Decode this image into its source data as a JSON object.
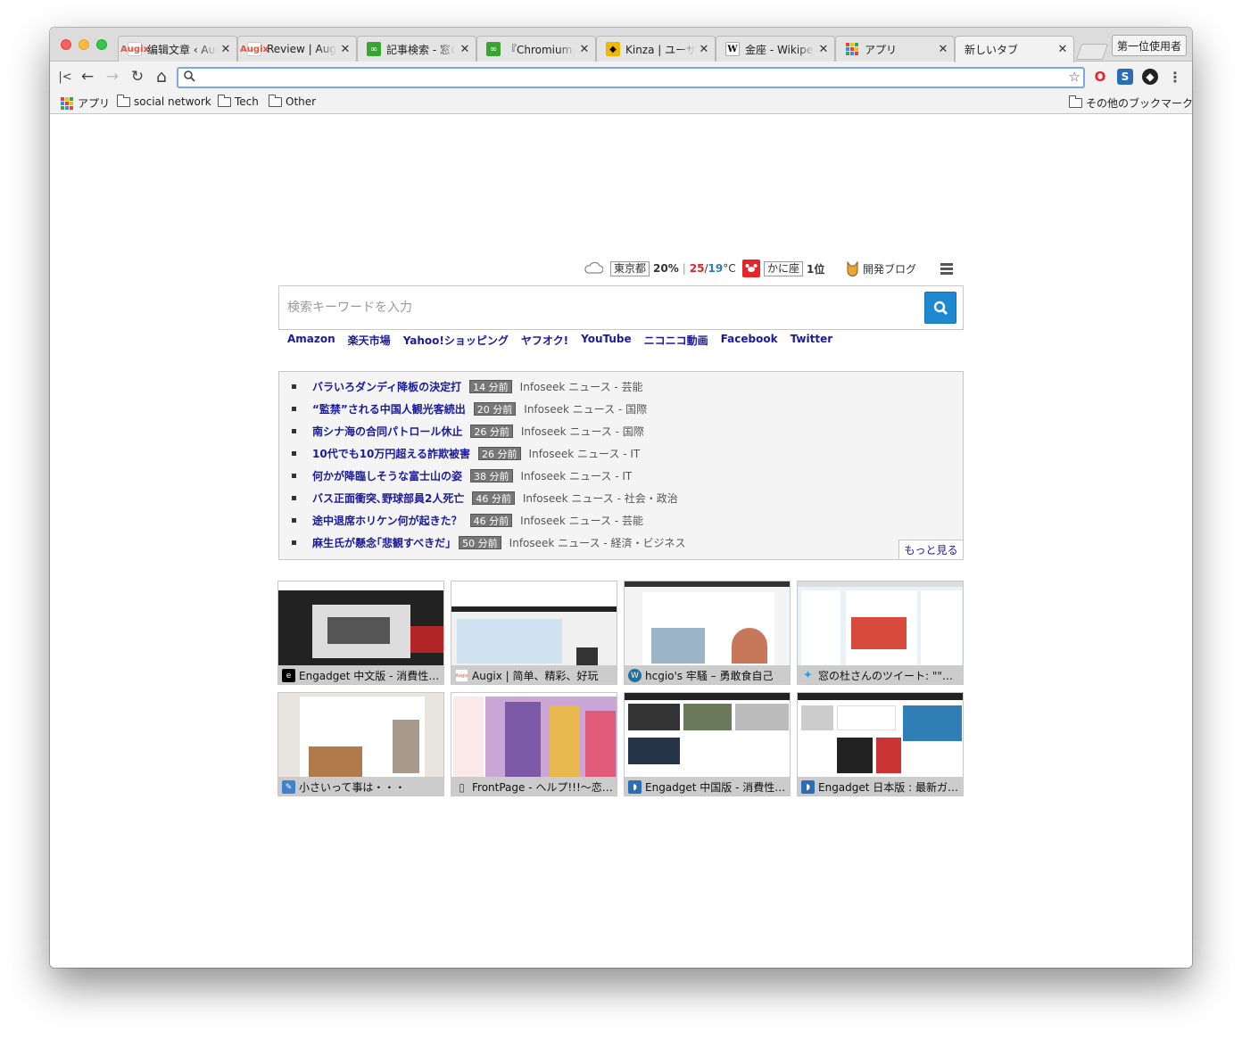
{
  "window": {
    "tabs": [
      {
        "title": "编辑文章 ‹ Aug",
        "favicon": "augix-icon"
      },
      {
        "title": "Review | Augix",
        "favicon": "augix-icon"
      },
      {
        "title": "記事検索 - 窓の",
        "favicon": "madonomori-icon"
      },
      {
        "title": "『Chromium』",
        "favicon": "madonomori-icon"
      },
      {
        "title": "Kinza | ユーザー",
        "favicon": "kinza-icon"
      },
      {
        "title": "金座 - Wikiped",
        "favicon": "wikipedia-icon"
      },
      {
        "title": "アプリ",
        "favicon": "apps-icon"
      },
      {
        "title": "新しいタブ",
        "favicon": "none"
      }
    ],
    "profile_label": "第一位使用者"
  },
  "toolbar": {
    "omnibox_value": "",
    "buttons": [
      "first-page-icon",
      "back-icon",
      "forward-icon",
      "reload-icon",
      "home-icon"
    ],
    "extensions": [
      "opera-icon",
      "s-extension-icon",
      "kinza-icon",
      "menu-dots-icon"
    ]
  },
  "bookmarks": {
    "items": [
      {
        "label": "アプリ",
        "icon": "apps-icon"
      },
      {
        "label": "social network",
        "icon": "folder-icon"
      },
      {
        "label": "Tech",
        "icon": "folder-icon"
      },
      {
        "label": "Other",
        "icon": "folder-icon"
      }
    ],
    "other_label": "その他のブックマーク"
  },
  "infobar": {
    "weather_icon": "cloud-icon",
    "location": "東京都",
    "precip": "20%",
    "temp_high": "25",
    "temp_sep": "/",
    "temp_low": "19",
    "temp_unit": "°C",
    "horoscope_sign": "かに座",
    "horoscope_rank": "1位",
    "dev_blog": "開発ブログ"
  },
  "search": {
    "placeholder": "検索キーワードを入力",
    "quicklinks": [
      "Amazon",
      "楽天市場",
      "Yahoo!ショッピング",
      "ヤフオク!",
      "YouTube",
      "ニコニコ動画",
      "Facebook",
      "Twitter"
    ]
  },
  "news": {
    "items": [
      {
        "title": "バラいろダンディ降板の決定打",
        "age": "14 分前",
        "source": "Infoseek ニュース - 芸能"
      },
      {
        "title": "“監禁”される中国人観光客続出",
        "age": "20 分前",
        "source": "Infoseek ニュース - 国際"
      },
      {
        "title": "南シナ海の合同パトロール休止",
        "age": "26 分前",
        "source": "Infoseek ニュース - 国際"
      },
      {
        "title": "10代でも10万円超える詐欺被害",
        "age": "26 分前",
        "source": "Infoseek ニュース - IT"
      },
      {
        "title": "何かが降臨しそうな富士山の姿",
        "age": "38 分前",
        "source": "Infoseek ニュース - IT"
      },
      {
        "title": "バス正面衝突､野球部員2人死亡",
        "age": "46 分前",
        "source": "Infoseek ニュース - 社会・政治"
      },
      {
        "title": "途中退席ホリケン何が起きた？",
        "age": "46 分前",
        "source": "Infoseek ニュース - 芸能"
      },
      {
        "title": "麻生氏が懸念｢悲観すべきだ｣",
        "age": "50 分前",
        "source": "Infoseek ニュース - 経済・ビジネス"
      }
    ],
    "more_label": "もっと見る"
  },
  "tiles": [
    {
      "caption": "Engadget 中文版 - 消費性電…",
      "icon": "engadget-icon"
    },
    {
      "caption": "Augix | 简单、精彩、好玩",
      "icon": "augix-icon"
    },
    {
      "caption": "hcgio's 牢騷 – 勇敢食自己",
      "icon": "wordpress-icon"
    },
    {
      "caption": "窓の杜さんのツイート: \"\"艦…",
      "icon": "twitter-icon"
    },
    {
      "caption": "小さいって事は・・・",
      "icon": "feather-icon"
    },
    {
      "caption": "FrontPage - ヘルプ!!!〜恋が…",
      "icon": "document-icon"
    },
    {
      "caption": "Engadget 中国版 - 消費性电…",
      "icon": "rss-icon"
    },
    {
      "caption": "Engadget 日本版 : 最新ガジ…",
      "icon": "rss-icon"
    }
  ]
}
